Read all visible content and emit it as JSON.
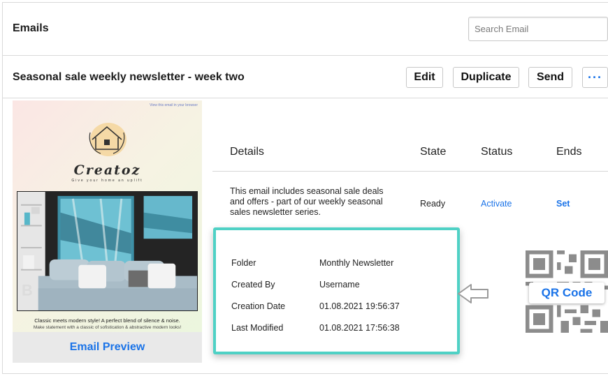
{
  "header": {
    "title": "Emails",
    "search_placeholder": "Search Email"
  },
  "toolbar": {
    "subject": "Seasonal sale weekly newsletter - week two",
    "edit_label": "Edit",
    "duplicate_label": "Duplicate",
    "send_label": "Send",
    "more_label": "···"
  },
  "preview": {
    "view_link": "View this email in your browser",
    "brand": "Creatoz",
    "tagline": "Give your home an uplift",
    "caption_line1": "Classic meets modern style! A perfect blend of silence & noise.",
    "caption_line2": "Make statement with a classic of sofistication & abstractive modern looks!",
    "footer_label": "Email Preview"
  },
  "table": {
    "headers": [
      "Details",
      "State",
      "Status",
      "Ends"
    ],
    "description": "This email includes seasonal sale deals and offers - part of our weekly seasonal sales newsletter series.",
    "state": "Ready",
    "status_action": "Activate",
    "ends_action": "Set"
  },
  "info": [
    {
      "label": "Folder",
      "value": "Monthly Newsletter"
    },
    {
      "label": "Created By",
      "value": "Username"
    },
    {
      "label": "Creation Date",
      "value": "01.08.2021 19:56:37"
    },
    {
      "label": "Last Modified",
      "value": "01.08.2021 17:56:38"
    }
  ],
  "qr": {
    "label": "QR Code"
  },
  "colors": {
    "accent": "#1a73e8",
    "highlight": "#4fd1c5"
  }
}
